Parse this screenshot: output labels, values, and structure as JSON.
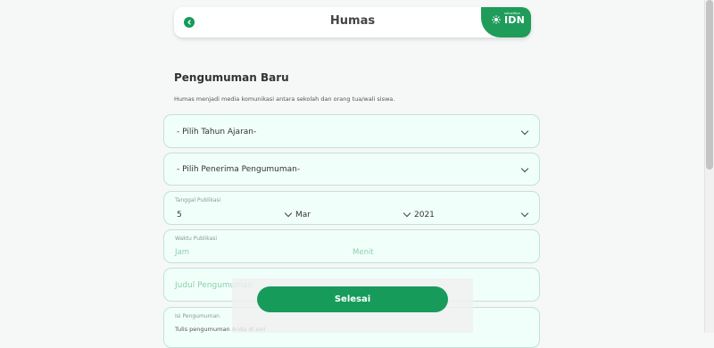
{
  "header": {
    "title": "Humas",
    "brand": {
      "small_text": "solusiNya",
      "name": "IDN",
      "color": "#1f9c5a"
    },
    "back_icon": "chevron-left-icon"
  },
  "section": {
    "title": "Pengumuman Baru",
    "description": "Humas menjadi media komunikasi antara sekolah dan orang tua/wali siswa."
  },
  "form": {
    "tahun_ajaran": {
      "selected": "- Pilih Tahun Ajaran-"
    },
    "penerima": {
      "selected": "- Pilih Penerima Pengumuman-"
    },
    "tanggal_publikasi": {
      "label": "Tanggal Publikasi",
      "day": "5",
      "month": "Mar",
      "year": "2021"
    },
    "waktu_publikasi": {
      "label": "Waktu Publikasi",
      "jam_placeholder": "Jam",
      "menit_placeholder": "Menit"
    },
    "judul": {
      "placeholder": "Judul Pengumuman"
    },
    "isi": {
      "label": "Isi Pengumuman",
      "placeholder": "Tulis pengumuman Anda di sini"
    }
  },
  "submit": {
    "label": "Selesai",
    "color": "#179b5b"
  }
}
